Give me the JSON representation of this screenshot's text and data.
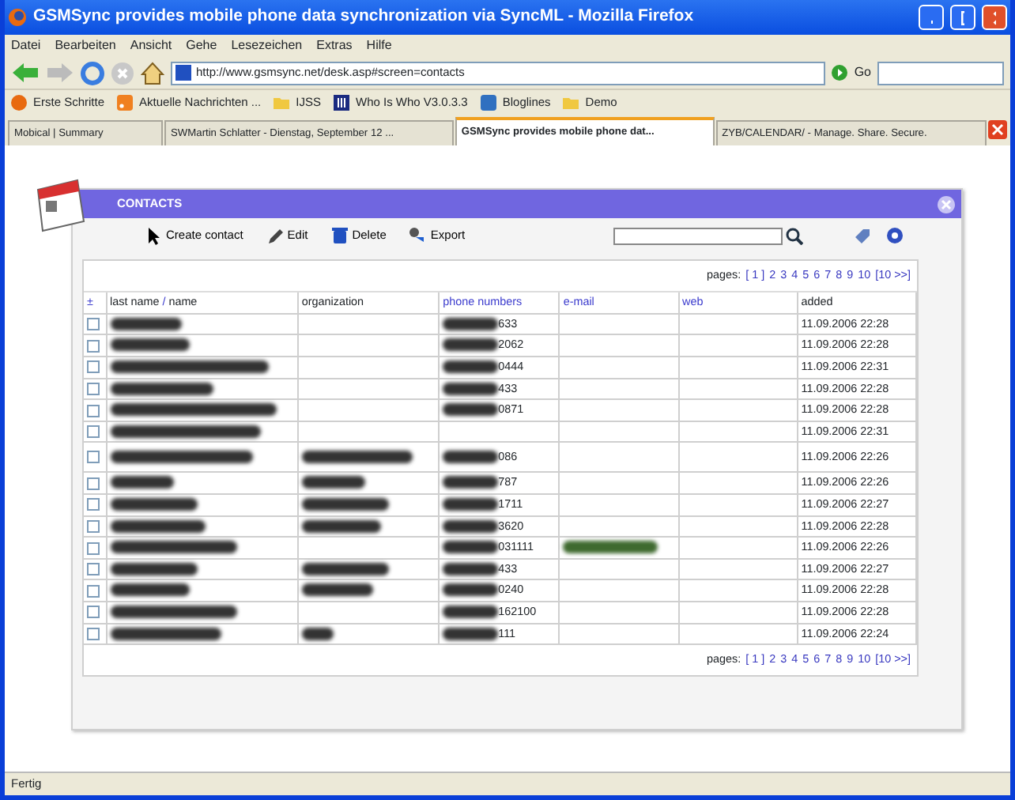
{
  "window": {
    "title": "GSMSync provides mobile phone data synchronization via SyncML - Mozilla Firefox"
  },
  "menu": [
    "Datei",
    "Bearbeiten",
    "Ansicht",
    "Gehe",
    "Lesezeichen",
    "Extras",
    "Hilfe"
  ],
  "address": {
    "value": "http://www.gsmsync.net/desk.asp#screen=contacts",
    "go": "Go"
  },
  "bookmarks": [
    {
      "kind": "firefox",
      "label": "Erste Schritte"
    },
    {
      "kind": "rss",
      "label": "Aktuelle Nachrichten ..."
    },
    {
      "kind": "folder",
      "label": "IJSS"
    },
    {
      "kind": "grid",
      "label": "Who Is Who V3.0.3.3"
    },
    {
      "kind": "b",
      "label": "Bloglines"
    },
    {
      "kind": "folder",
      "label": "Demo"
    }
  ],
  "tabs": [
    {
      "label": "Mobical | Summary",
      "selected": false
    },
    {
      "label": "SWMartin Schlatter - Dienstag, September 12 ...",
      "selected": false
    },
    {
      "label": "GSMSync provides mobile phone dat...",
      "selected": true
    },
    {
      "label": "ZYB/CALENDAR/ - Manage. Share. Secure.",
      "selected": false
    }
  ],
  "panel": {
    "title": "CONTACTS",
    "actions": [
      "Create contact",
      "Edit",
      "Delete",
      "Export"
    ]
  },
  "pager_top": {
    "label": "pages:",
    "pages": [
      "[ 1 ]",
      "2",
      "3",
      "4",
      "5",
      "6",
      "7",
      "8",
      "9",
      "10",
      "[10 >>]"
    ]
  },
  "pager_bottom": {
    "label": "pages:",
    "pages": [
      "[ 1 ]",
      "2",
      "3",
      "4",
      "5",
      "6",
      "7",
      "8",
      "9",
      "10",
      "[10 >>]"
    ]
  },
  "columns": [
    "±",
    "last name",
    "/",
    "name",
    "organization",
    "phone numbers",
    "e-mail",
    "web",
    "added"
  ],
  "rows": [
    {
      "checked": false,
      "org_redacted": false,
      "phone": "633",
      "email_redacted": false,
      "added": "11.09.2006 22:28"
    },
    {
      "checked": false,
      "org_redacted": false,
      "phone": "2062",
      "email_redacted": false,
      "added": "11.09.2006 22:28"
    },
    {
      "checked": false,
      "org_redacted": false,
      "phone": "0444",
      "email_redacted": false,
      "added": "11.09.2006 22:31"
    },
    {
      "checked": false,
      "org_redacted": false,
      "phone": "433",
      "email_redacted": false,
      "added": "11.09.2006 22:28"
    },
    {
      "checked": false,
      "org_redacted": false,
      "phone": "0871",
      "email_redacted": false,
      "added": "11.09.2006 22:28"
    },
    {
      "checked": false,
      "org_redacted": false,
      "phone": "",
      "email_redacted": false,
      "added": "11.09.2006 22:31"
    },
    {
      "checked": false,
      "org_redacted": true,
      "phone": "086",
      "email_redacted": false,
      "added": "11.09.2006 22:26"
    },
    {
      "checked": false,
      "org_redacted": true,
      "phone": "787",
      "email_redacted": false,
      "added": "11.09.2006 22:26"
    },
    {
      "checked": false,
      "org_redacted": true,
      "phone": "1711",
      "email_redacted": false,
      "added": "11.09.2006 22:27"
    },
    {
      "checked": false,
      "org_redacted": true,
      "phone": "3620",
      "email_redacted": false,
      "added": "11.09.2006 22:28"
    },
    {
      "checked": false,
      "org_redacted": false,
      "phone": "031111",
      "email_redacted": true,
      "added": "11.09.2006 22:26"
    },
    {
      "checked": false,
      "org_redacted": true,
      "phone": "433",
      "email_redacted": false,
      "added": "11.09.2006 22:27"
    },
    {
      "checked": false,
      "org_redacted": true,
      "phone": "0240",
      "email_redacted": false,
      "added": "11.09.2006 22:28"
    },
    {
      "checked": false,
      "org_redacted": false,
      "phone": "162100",
      "email_redacted": false,
      "added": "11.09.2006 22:28"
    },
    {
      "checked": false,
      "org_redacted": true,
      "phone": "111",
      "email_redacted": false,
      "added": "11.09.2006 22:24"
    }
  ],
  "status_bar": "Fertig"
}
